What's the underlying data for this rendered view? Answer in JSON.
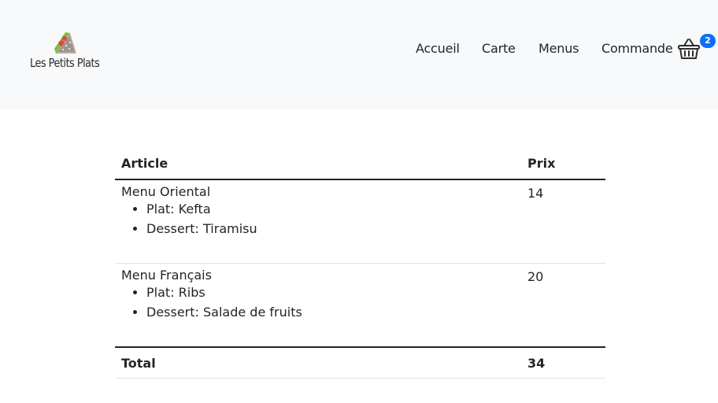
{
  "brand": {
    "name": "Les Petits Plats",
    "logo_icon": "sandwich-icon"
  },
  "nav": {
    "links": [
      "Accueil",
      "Carte",
      "Menus",
      "Commande"
    ],
    "cart_icon": "basket-icon",
    "cart_count": "2",
    "colors": {
      "navbar_bg": "#f8f9fa",
      "badge": "#0d6efd"
    }
  },
  "order": {
    "headers": {
      "article": "Article",
      "price": "Prix"
    },
    "items": [
      {
        "name": "Menu Oriental",
        "plat": "Plat: Kefta",
        "dessert": "Dessert: Tiramisu",
        "price": "14"
      },
      {
        "name": "Menu Français",
        "plat": "Plat: Ribs",
        "dessert": "Dessert: Salade de fruits",
        "price": "20"
      }
    ],
    "total_label": "Total",
    "total_value": "34"
  }
}
